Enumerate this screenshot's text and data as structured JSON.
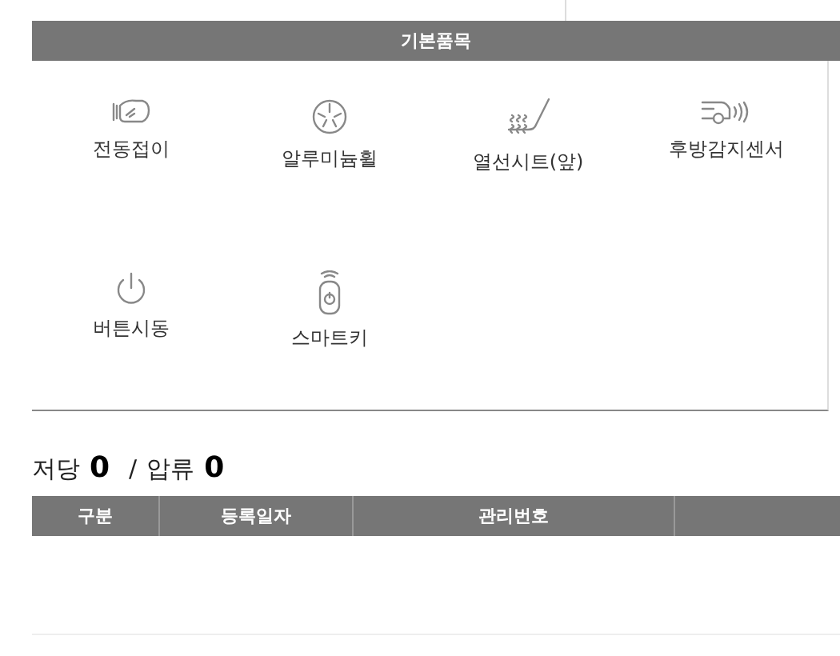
{
  "section": {
    "title": "기본품목",
    "items": [
      {
        "label": "전동접이"
      },
      {
        "label": "알루미늄휠"
      },
      {
        "label": "열선시트(앞)"
      },
      {
        "label": "후방감지센서"
      },
      {
        "label": "버튼시동"
      },
      {
        "label": "스마트키"
      }
    ]
  },
  "summary": {
    "mortgage_label": "저당",
    "mortgage_count": "0",
    "separator": "/",
    "seizure_label": "압류",
    "seizure_count": "0"
  },
  "table": {
    "columns": [
      "구분",
      "등록일자",
      "관리번호"
    ]
  }
}
